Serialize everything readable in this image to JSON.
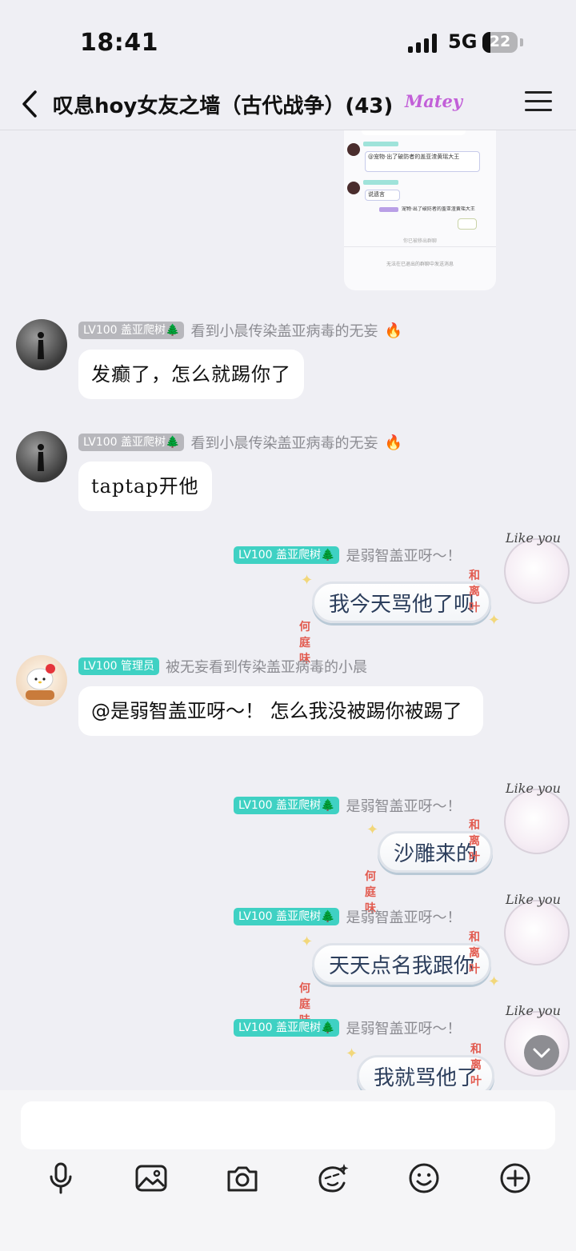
{
  "status_bar": {
    "time": "18:41",
    "network": "5G",
    "battery": "22",
    "battery_level": 0.22
  },
  "header": {
    "title": "叹息hoy女友之墙（古代战争）(43)",
    "badge": "Matey"
  },
  "screenshot_preview": {
    "rows": [
      "@宠物·出了破防者的盖亚渣黄瑶大王",
      "说遗言",
      "宠物·出了破防者的盖亚渣黄瑶大王"
    ],
    "footer_kick": "你已被移出群聊",
    "footer_notice": "无法在已退出的群聊中发送消息"
  },
  "messages": [
    {
      "level": "LV100",
      "title": "盖亚爬树🌲",
      "nick": "看到小晨传染盖亚病毒的无妄",
      "emoji": "🔥",
      "text": "发癫了，怎么就踢你了"
    },
    {
      "level": "LV100",
      "title": "盖亚爬树🌲",
      "nick": "看到小晨传染盖亚病毒的无妄",
      "emoji": "🔥",
      "text": "taptap开他"
    },
    {
      "level": "LV100",
      "title": "盖亚爬树🌲",
      "nick": "是弱智盖亚呀～！",
      "text": "我今天骂他了呗"
    },
    {
      "level": "LV100",
      "title": "管理员",
      "nick": "被无妄看到传染盖亚病毒的小晨",
      "text": "@是弱智盖亚呀～！ 怎么我没被踢你被踢了"
    },
    {
      "level": "LV100",
      "title": "盖亚爬树🌲",
      "nick": "是弱智盖亚呀～！",
      "text": "沙雕来的"
    },
    {
      "level": "LV100",
      "title": "盖亚爬树🌲",
      "nick": "是弱智盖亚呀～！",
      "text": "天天点名我跟你"
    },
    {
      "level": "LV100",
      "title": "盖亚爬树🌲",
      "nick": "是弱智盖亚呀～！",
      "text": "我就骂他了"
    }
  ],
  "bubble_decor": {
    "top": "和离叶",
    "bottom": "何庭味",
    "pendant": "Like you"
  },
  "input": {
    "placeholder": ""
  },
  "toolbar": [
    "mic-icon",
    "image-icon",
    "camera-icon",
    "sticker-icon",
    "emoji-icon",
    "plus-icon"
  ]
}
